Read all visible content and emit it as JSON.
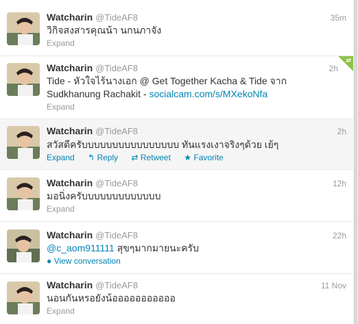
{
  "tweets": [
    {
      "name": "Watcharin",
      "handle": "@TideAF8",
      "time": "35m",
      "text": "วิกิจสงสารคุณน้า นกนภาจัง",
      "expand": "Expand"
    },
    {
      "name": "Watcharin",
      "handle": "@TideAF8",
      "time": "2h",
      "text_before": "Tide - หัวใจไร้นางเอก @ Get Together Kacha & Tide จาก Sudkhanung Rachakit - ",
      "link": "socialcam.com/s/MXekoNfa",
      "expand": "Expand"
    },
    {
      "name": "Watcharin",
      "handle": "@TideAF8",
      "time": "2h",
      "text": "สวัสดีครับบบบบบบบบบบบบบบบ ทันแรงเงาจริงๆด้วย เย้ๆ",
      "expand": "Expand",
      "reply": "Reply",
      "retweet": "Retweet",
      "favorite": "Favorite"
    },
    {
      "name": "Watcharin",
      "handle": "@TideAF8",
      "time": "12h",
      "text": "มอนิ่งครับบบบบบบบบบบบบ",
      "expand": "Expand"
    },
    {
      "name": "Watcharin",
      "handle": "@TideAF8",
      "time": "22h",
      "mention": "@c_aom911111",
      "text_after": " สุขๆมากมายนะครับ",
      "conversation": "View conversation"
    },
    {
      "name": "Watcharin",
      "handle": "@TideAF8",
      "time": "11 Nov",
      "text": "นอนกันหรอยังน้อออออออออออ",
      "expand": "Expand"
    }
  ],
  "colors": {
    "link": "#0084b4",
    "muted": "#999999",
    "text": "#333333",
    "hover_bg": "#f5f5f5",
    "ribbon": "#8fc34a"
  },
  "icons": {
    "reply": "reply-arrow-icon",
    "retweet": "retweet-icon",
    "favorite": "star-icon",
    "conversation": "speech-bubble-icon"
  }
}
